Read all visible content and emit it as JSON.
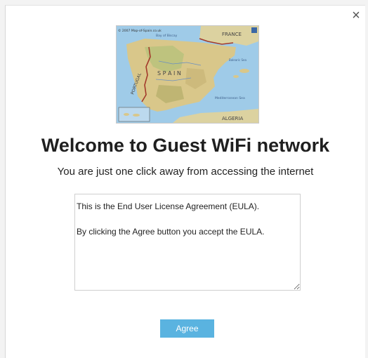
{
  "dialog": {
    "close_label": "×",
    "title": "Welcome to Guest WiFi network",
    "subtitle": "You are just one click away from accessing the internet",
    "eula_text": "This is the End User License Agreement (EULA).\n\nBy clicking the Agree button you accept the EULA.",
    "agree_label": "Agree"
  },
  "map": {
    "copyright": "© 2007 Map-of-Spain.co.uk",
    "labels": {
      "france": "FRANCE",
      "spain": "S P A I N",
      "portugal": "PORTUGAL",
      "algeria": "ALGERIA",
      "bay": "Bay of Biscay",
      "med": "Mediterranean Sea",
      "balearic": "Balearic Sea"
    }
  },
  "colors": {
    "agree_button": "#5ab3e0",
    "sea": "#9fcbe8",
    "land": "#d9c78a",
    "border_line": "#a33a2b"
  }
}
